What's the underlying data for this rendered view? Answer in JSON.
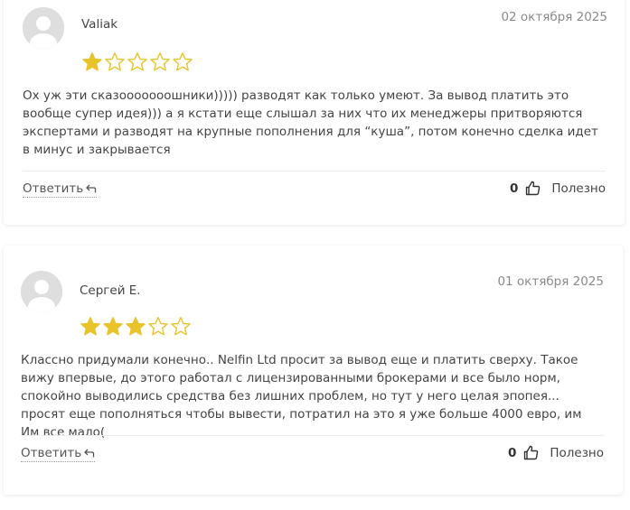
{
  "reviews": [
    {
      "author": "Valiak",
      "date": "02 октября 2025",
      "rating": 1,
      "max_rating": 5,
      "text": "Ох уж эти сказооооооошники))))) разводят как только умеют. За вывод платить это вообще супер идея))) а я кстати еще слышал за них что их менеджеры притворяются экспертами и разводят на крупные пополнения для “куша”, потом конечно сделка идет в минус и закрывается",
      "reply_label": "Ответить",
      "useful_count": "0",
      "useful_label": "Полезно"
    },
    {
      "author": "Сергей Е.",
      "date": "01 октября 2025",
      "rating": 3,
      "max_rating": 5,
      "text": "Классно придумали конечно.. Nelfin Ltd просит за вывод еще и платить сверху. Такое вижу впервые, до этого работал с лицензированными брокерами и все было норм, спокойно выводились средства без лишних проблем, но тут у него целая эпопея... просят еще пополняться чтобы вывести, потратил на это я уже больше 4000 евро, им Им все мало(",
      "reply_label": "Ответить",
      "useful_count": "0",
      "useful_label": "Полезно"
    }
  ],
  "colors": {
    "star_filled": "#e8c42a",
    "star_outline": "#e8c42a",
    "avatar_bg": "#dedede",
    "avatar_fg": "#ffffff"
  },
  "icons": {
    "avatar": "user-placeholder-icon",
    "reply": "reply-arrow-icon",
    "useful": "thumbs-up-icon",
    "star": "star-icon"
  }
}
